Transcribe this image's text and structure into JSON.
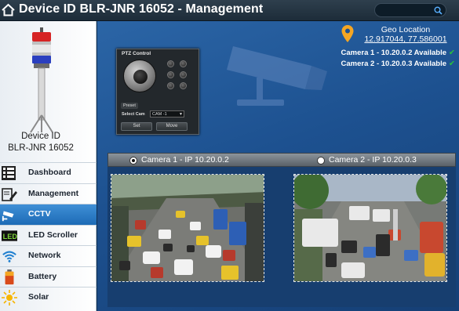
{
  "window": {
    "title": "Device ID BLR-JNR 16052 - Management"
  },
  "search": {
    "placeholder": "",
    "icon": "search-icon"
  },
  "device": {
    "label_line1": "Device ID",
    "label_line2": "BLR-JNR 16052"
  },
  "sidebar": {
    "items": [
      {
        "label": "Dashboard",
        "icon": "dashboard-icon",
        "active": false
      },
      {
        "label": "Management",
        "icon": "management-icon",
        "active": false
      },
      {
        "label": "CCTV",
        "icon": "cctv-icon",
        "active": true
      },
      {
        "label": "LED Scroller",
        "icon": "led-icon",
        "active": false
      },
      {
        "label": "Network",
        "icon": "wifi-icon",
        "active": false
      },
      {
        "label": "Battery",
        "icon": "battery-icon",
        "active": false
      },
      {
        "label": "Solar",
        "icon": "solar-icon",
        "active": false
      }
    ]
  },
  "ptz": {
    "title": "PTZ Control",
    "preset_label": "Preset",
    "select_cam_label": "Select Cam",
    "selected_cam": "CAM -1",
    "set_label": "Set",
    "move_label": "Move"
  },
  "geo": {
    "title": "Geo Location",
    "coords": "12.917044, 77.586001"
  },
  "cameras": {
    "status": [
      {
        "text": "Camera 1 - 10.20.0.2  Available",
        "available": true
      },
      {
        "text": "Camera 2 - 10.20.0.3  Available",
        "available": true
      }
    ],
    "tabs": [
      {
        "label": "Camera 1 - IP 10.20.0.2",
        "selected": true
      },
      {
        "label": "Camera 2 - IP 10.20.0.3",
        "selected": false
      }
    ]
  },
  "colors": {
    "accent": "#1d6bb6",
    "background": "#1d5190",
    "available": "#28c43a",
    "geo_pin": "#f5a623"
  }
}
